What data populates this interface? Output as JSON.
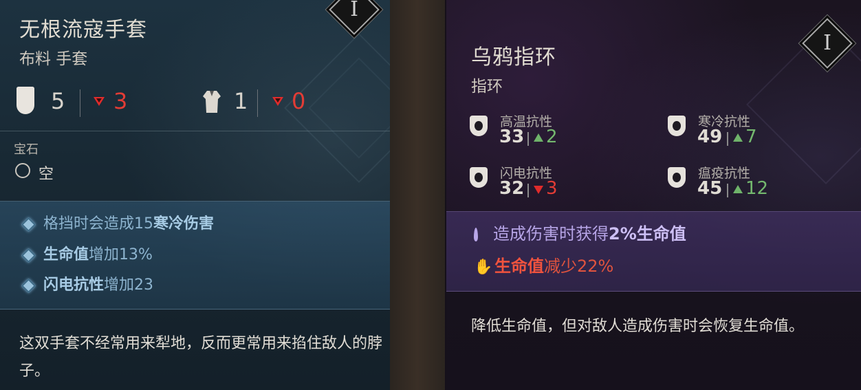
{
  "left": {
    "level": "I",
    "title": "无根流寇手套",
    "subtitle": "布料 手套",
    "armor": {
      "value": "5",
      "delta": "3"
    },
    "weight": {
      "value": "1",
      "delta": "0"
    },
    "gem_label": "宝石",
    "gem_slot": "空",
    "affixes": [
      {
        "pre": "格挡时会造成15",
        "bold": "寒冷伤害",
        "post": ""
      },
      {
        "pre": "",
        "bold": "生命值",
        "post": "增加13%"
      },
      {
        "pre": "",
        "bold": "闪电抗性",
        "post": "增加23"
      }
    ],
    "flavor": "这双手套不经常用来犁地，反而更常用来掐住敌人的脖子。"
  },
  "right": {
    "level": "I",
    "title": "乌鸦指环",
    "subtitle": "指环",
    "resists": [
      {
        "label": "高温抗性",
        "value": "33",
        "delta": "2",
        "dir": "up",
        "icon": "fire-resist-icon"
      },
      {
        "label": "寒冷抗性",
        "value": "49",
        "delta": "7",
        "dir": "up",
        "icon": "cold-resist-icon"
      },
      {
        "label": "闪电抗性",
        "value": "32",
        "delta": "3",
        "dir": "down",
        "icon": "lightning-resist-icon"
      },
      {
        "label": "瘟疫抗性",
        "value": "45",
        "delta": "12",
        "dir": "up",
        "icon": "plague-resist-icon"
      }
    ],
    "affixes": [
      {
        "pre": "造成伤害时获得",
        "bold": "2%生命值",
        "post": "",
        "type": "good",
        "icon": "feather-icon"
      },
      {
        "pre": "",
        "bold": "生命值",
        "post": "减少22%",
        "type": "bad",
        "icon": "bloody-hand-icon"
      }
    ],
    "flavor": "降低生命值，但对敌人造成伤害时会恢复生命值。"
  },
  "colors": {
    "buff": "#74b86e",
    "debuff": "#e23c35",
    "left_affix": "#8db4cf",
    "right_affix": "#b6a4e6"
  }
}
